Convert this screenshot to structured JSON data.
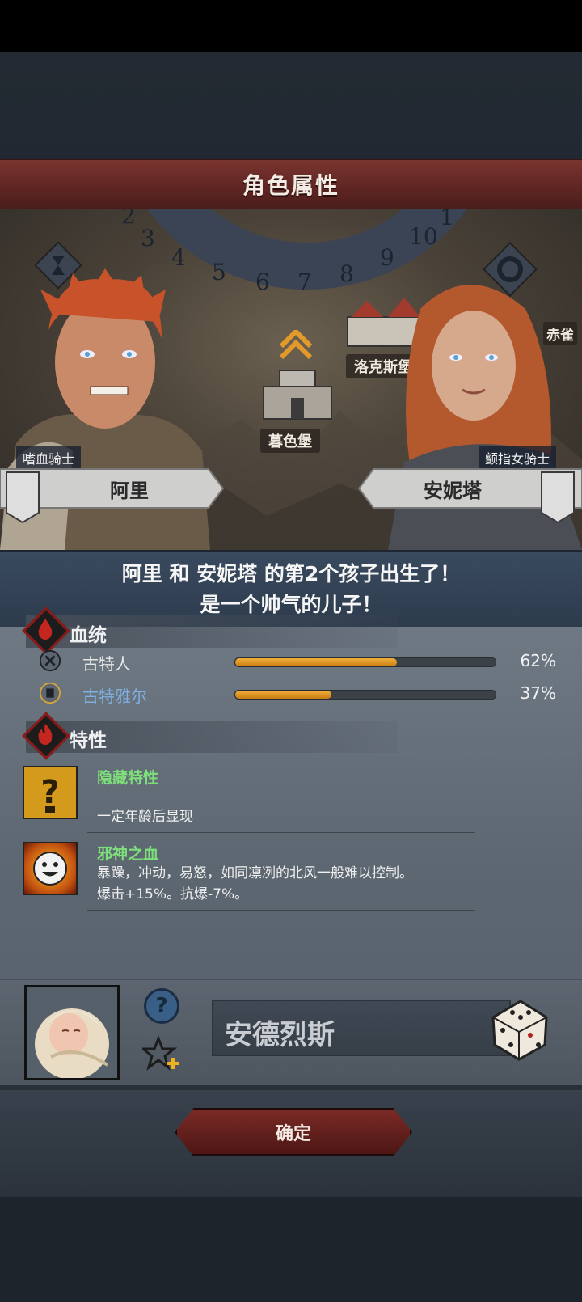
{
  "header": {
    "title": "角色属性"
  },
  "scene": {
    "dial_numbers": [
      "2",
      "3",
      "4",
      "5",
      "6",
      "7",
      "8",
      "9",
      "10",
      "1"
    ],
    "places": {
      "left_castle": "暮色堡",
      "right_castle": "洛克斯堡",
      "edge_label": "赤雀"
    },
    "father": {
      "rank": "嗜血骑士",
      "name": "阿里"
    },
    "mother": {
      "rank": "颤指女骑士",
      "name": "安妮塔"
    }
  },
  "announcement": {
    "line1": "阿里 和 安妮塔 的第2个孩子出生了！",
    "line2": "是一个帅气的儿子！"
  },
  "bloodline": {
    "heading": "血统",
    "rows": [
      {
        "name": "古特人",
        "percent_label": "62%",
        "fraction": 0.62,
        "color": "#e6e6e6"
      },
      {
        "name": "古特雅尔",
        "percent_label": "37%",
        "fraction": 0.37,
        "color": "#7fb0e0"
      }
    ]
  },
  "traits": {
    "heading": "特性",
    "items": [
      {
        "name": "隐藏特性",
        "desc_lines": [
          "一定年龄后显现"
        ]
      },
      {
        "name": "邪神之血",
        "desc_lines": [
          "暴躁，冲动，易怒，如同凛冽的北风一般难以控制。",
          "爆击+15%。抗爆-7%。"
        ]
      }
    ]
  },
  "child": {
    "name_value": "安德烈斯"
  },
  "footer": {
    "confirm_label": "确定"
  }
}
